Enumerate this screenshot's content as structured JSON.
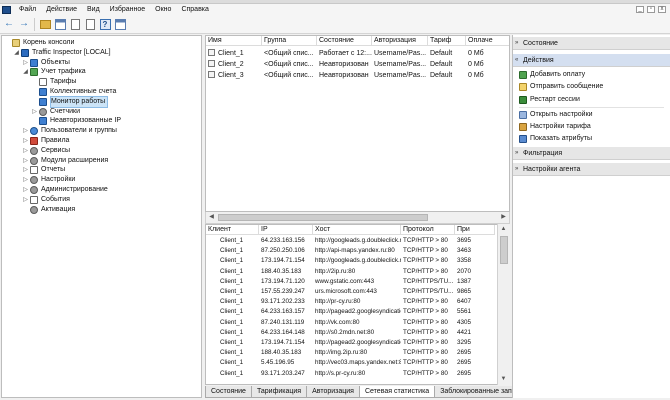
{
  "menu": [
    "Файл",
    "Действие",
    "Вид",
    "Избранное",
    "Окно",
    "Справка"
  ],
  "tree": [
    {
      "label": "Корень консоли",
      "icon": "root",
      "level": 0,
      "expander": ""
    },
    {
      "label": "Traffic Inspector [LOCAL]",
      "icon": "ti",
      "level": 1,
      "expander": "◢"
    },
    {
      "label": "Объекты",
      "icon": "blue",
      "level": 2,
      "expander": "▷"
    },
    {
      "label": "Учет трафика",
      "icon": "green",
      "level": 2,
      "expander": "◢"
    },
    {
      "label": "Тарифы",
      "icon": "doc",
      "level": 3,
      "expander": ""
    },
    {
      "label": "Коллективные счета",
      "icon": "blue",
      "level": 3,
      "expander": ""
    },
    {
      "label": "Монитор работы",
      "icon": "blue",
      "level": 3,
      "expander": "",
      "selected": true
    },
    {
      "label": "Счетчики",
      "icon": "gear",
      "level": 3,
      "expander": "▷"
    },
    {
      "label": "Неавторизованные IP",
      "icon": "blue",
      "level": 3,
      "expander": ""
    },
    {
      "label": "Пользователи и группы",
      "icon": "users",
      "level": 2,
      "expander": "▷"
    },
    {
      "label": "Правила",
      "icon": "red",
      "level": 2,
      "expander": "▷"
    },
    {
      "label": "Сервисы",
      "icon": "gear",
      "level": 2,
      "expander": "▷"
    },
    {
      "label": "Модули расширения",
      "icon": "gear",
      "level": 2,
      "expander": "▷"
    },
    {
      "label": "Отчеты",
      "icon": "doc",
      "level": 2,
      "expander": "▷"
    },
    {
      "label": "Настройки",
      "icon": "gear",
      "level": 2,
      "expander": "▷"
    },
    {
      "label": "Администрирование",
      "icon": "gear",
      "level": 2,
      "expander": "▷"
    },
    {
      "label": "События",
      "icon": "doc",
      "level": 2,
      "expander": "▷"
    },
    {
      "label": "Активация",
      "icon": "gear",
      "level": 2,
      "expander": ""
    }
  ],
  "sessions": {
    "columns": [
      "Имя",
      "Группа",
      "Состояние",
      "Авторизация",
      "Тариф",
      "Оплаче"
    ],
    "rows": [
      [
        "Client_1",
        "<Общий спис...",
        "Работает с 12:...",
        "Username/Pas...",
        "Default",
        "0 Мб"
      ],
      [
        "Client_2",
        "<Общий спис...",
        "Неавторизован",
        "Username/Pas...",
        "Default",
        "0 Мб"
      ],
      [
        "Client_3",
        "<Общий спис...",
        "Неавторизован",
        "Username/Pas...",
        "Default",
        "0 Мб"
      ]
    ]
  },
  "requests": {
    "columns": [
      "Клиент",
      "IP",
      "Хост",
      "Протокол",
      "При"
    ],
    "rows": [
      [
        "Client_1",
        "64.233.163.156",
        "http://googleads.g.doubleclick.net:80",
        "TCP/HTTP > 80",
        "3695"
      ],
      [
        "Client_1",
        "87.250.250.106",
        "http://api-maps.yandex.ru:80",
        "TCP/HTTP > 80",
        "3463"
      ],
      [
        "Client_1",
        "173.194.71.154",
        "http://googleads.g.doubleclick.net:80",
        "TCP/HTTP > 80",
        "3358"
      ],
      [
        "Client_1",
        "188.40.35.183",
        "http://2ip.ru:80",
        "TCP/HTTP > 80",
        "2070"
      ],
      [
        "Client_1",
        "173.194.71.120",
        "www.gstatic.com:443",
        "TCP/HTTPS/TU...",
        "1387"
      ],
      [
        "Client_1",
        "157.55.239.247",
        "urs.microsoft.com:443",
        "TCP/HTTPS/TU...",
        "9865"
      ],
      [
        "Client_1",
        "93.171.202.233",
        "http://pr-cy.ru:80",
        "TCP/HTTP > 80",
        "6407"
      ],
      [
        "Client_1",
        "64.233.163.157",
        "http://pagead2.googlesyndication.c...",
        "TCP/HTTP > 80",
        "5561"
      ],
      [
        "Client_1",
        "87.240.131.119",
        "http://vk.com:80",
        "TCP/HTTP > 80",
        "4305"
      ],
      [
        "Client_1",
        "64.233.164.148",
        "http://s0.2mdn.net:80",
        "TCP/HTTP > 80",
        "4421"
      ],
      [
        "Client_1",
        "173.194.71.154",
        "http://pagead2.googlesyndication.c...",
        "TCP/HTTP > 80",
        "3295"
      ],
      [
        "Client_1",
        "188.40.35.183",
        "http://img.2ip.ru:80",
        "TCP/HTTP > 80",
        "2695"
      ],
      [
        "Client_1",
        "5.45.196.95",
        "http://vec03.maps.yandex.net:80",
        "TCP/HTTP > 80",
        "2695"
      ],
      [
        "Client_1",
        "93.171.203.247",
        "http://s.pr-cy.ru:80",
        "TCP/HTTP > 80",
        "2695"
      ]
    ]
  },
  "tabs": [
    "Состояние",
    "Тарификация",
    "Авторизация",
    "Сетевая статистика",
    "Заблокированные запросы",
    "Прокси сервер",
    "Почтовые запросы"
  ],
  "actions": {
    "sections": [
      "Состояние",
      "Действия",
      "Фильтрация",
      "Настройки агента"
    ],
    "items": [
      "Добавить оплату",
      "Отправить сообщение",
      "Рестарт сессии",
      "Открыть настройки",
      "Настройки тарифа",
      "Показать атрибуты"
    ]
  },
  "scrollbar_arrows": {
    "left": "◀",
    "right": "▶",
    "up": "▲",
    "down": "▼"
  },
  "window_controls": [
    "_",
    "▫",
    "x"
  ]
}
